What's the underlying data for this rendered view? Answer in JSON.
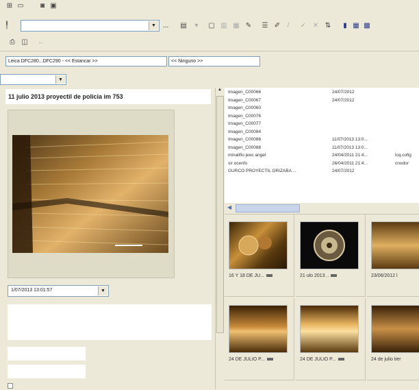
{
  "toolbar": {
    "top_icons": [
      "grid-icon",
      "window-icon",
      "camera-icon",
      "monitor-icon"
    ],
    "ellipsis_label": "...",
    "nav_icons": [
      "print-icon",
      "print-preview-icon",
      "back-arrow-icon"
    ]
  },
  "filter": {
    "field_text": "Leica DFC280...DFC290 - << Estancar >>",
    "second_field_text": "<< Ninguno >>"
  },
  "left_panel": {
    "title": "11 julio 2013 proyectil de policia im 753",
    "date_value": "1/07/2013 13:01:57"
  },
  "file_list": {
    "rows": [
      {
        "name": "Imagen_C00066",
        "date": "24/07/2012",
        "extra": ""
      },
      {
        "name": "Imagen_C00067",
        "date": "24/07/2012",
        "extra": ""
      },
      {
        "name": "Imagen_C00060",
        "date": "",
        "extra": ""
      },
      {
        "name": "Imagen_C00076",
        "date": "",
        "extra": ""
      },
      {
        "name": "Imagen_C00077",
        "date": "",
        "extra": ""
      },
      {
        "name": "Imagen_C00084",
        "date": "",
        "extra": ""
      },
      {
        "name": "Imagen_C00086",
        "date": "11/07/2013 13:0...",
        "extra": ""
      },
      {
        "name": "Imagen_C00088",
        "date": "11/07/2013 13:0...",
        "extra": ""
      },
      {
        "name": "minalifio jeoc angel",
        "date": "24/04/2011 21:4...",
        "extra": "lcq.cofig"
      },
      {
        "name": "sir ocenfo",
        "date": "26/04/2011 21:4...",
        "extra": "cnodor"
      },
      {
        "name": "GURCO PROYECTIL ORIZABA ...",
        "date": "24/07/2012",
        "extra": ""
      }
    ]
  },
  "thumbnails": [
    {
      "caption": "16 Y 18 DE JU..."
    },
    {
      "caption": "21 ulo 2013 .."
    },
    {
      "caption": "23/06/2012 l"
    },
    {
      "caption": "24 DE JULIO P..."
    },
    {
      "caption": "24 DE JULIO P..."
    },
    {
      "caption": "24 de julio tier"
    }
  ]
}
